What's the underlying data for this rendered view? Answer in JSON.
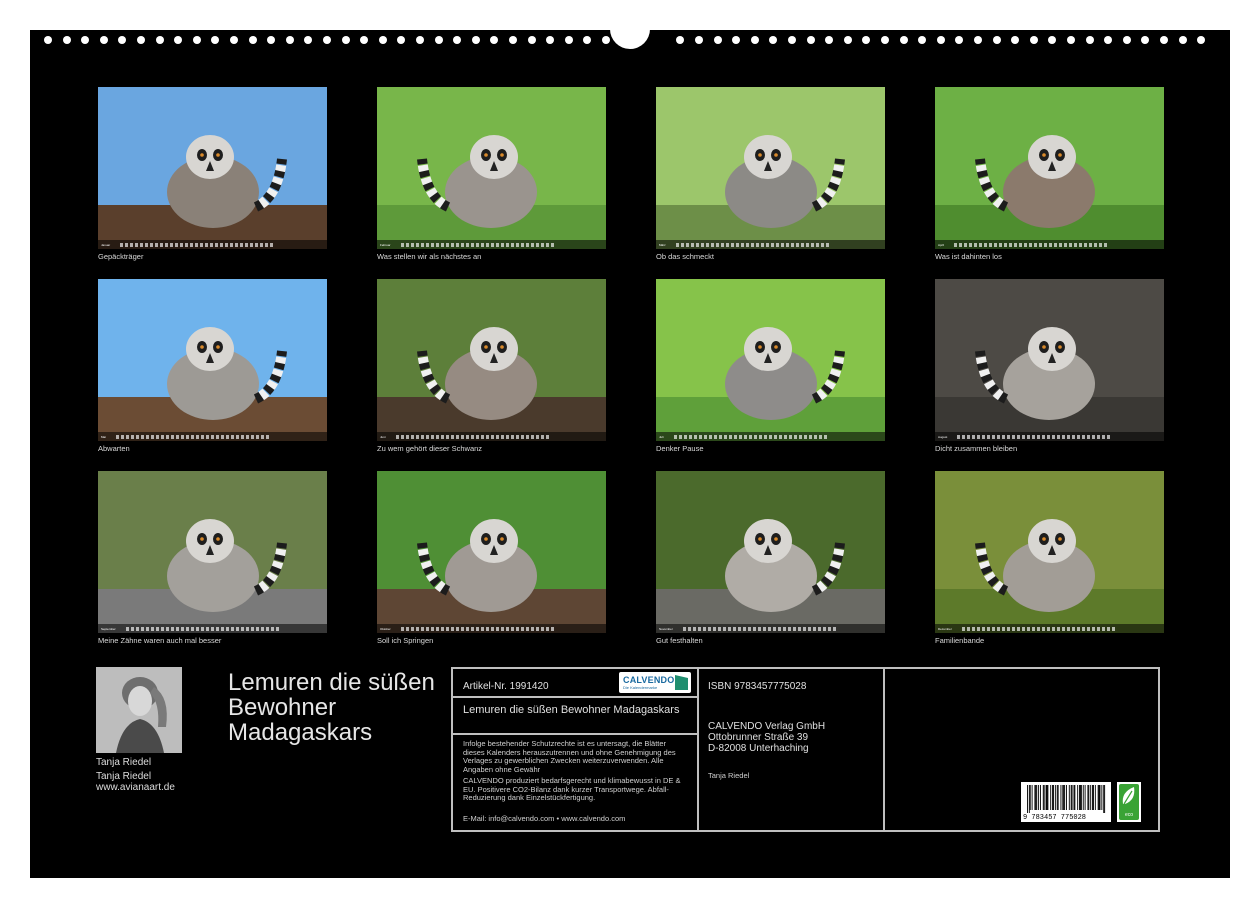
{
  "calendar": {
    "months": [
      {
        "month": "Januar",
        "caption": "Gepäckträger",
        "palette": {
          "bg": "#6aa6e0",
          "ground": "#5a3f2c",
          "subject": "#8a8178"
        }
      },
      {
        "month": "Februar",
        "caption": "Was stellen wir als nächstes an",
        "palette": {
          "bg": "#78b64a",
          "ground": "#5e9a3a",
          "subject": "#9a948e"
        }
      },
      {
        "month": "März",
        "caption": "Ob das schmeckt",
        "palette": {
          "bg": "#9cc66b",
          "ground": "#6d8f48",
          "subject": "#8c8a86"
        }
      },
      {
        "month": "April",
        "caption": "Was ist dahinten los",
        "palette": {
          "bg": "#6db045",
          "ground": "#4f8d2f",
          "subject": "#8b7a6c"
        }
      },
      {
        "month": "Mai",
        "caption": "Abwarten",
        "palette": {
          "bg": "#6fb3ec",
          "ground": "#6b4c34",
          "subject": "#9d9a95"
        }
      },
      {
        "month": "Juni",
        "caption": "Zu wem gehört dieser Schwanz",
        "palette": {
          "bg": "#5d7f3a",
          "ground": "#4a3a2c",
          "subject": "#968b82"
        }
      },
      {
        "month": "Juli",
        "caption": "Denker Pause",
        "palette": {
          "bg": "#86c34a",
          "ground": "#5fa03a",
          "subject": "#8e8c8a"
        }
      },
      {
        "month": "August",
        "caption": "Dicht zusammen bleiben",
        "palette": {
          "bg": "#4d4a45",
          "ground": "#3a3834",
          "subject": "#a6a29c"
        }
      },
      {
        "month": "September",
        "caption": "Meine Zähne waren auch mal besser",
        "palette": {
          "bg": "#6a7f4a",
          "ground": "#7a7a7a",
          "subject": "#a3a09b"
        }
      },
      {
        "month": "Oktober",
        "caption": "Soll ich Springen",
        "palette": {
          "bg": "#4f8f35",
          "ground": "#5e4634",
          "subject": "#a09a94"
        }
      },
      {
        "month": "November",
        "caption": "Gut festhalten",
        "palette": {
          "bg": "#4b6a2c",
          "ground": "#6a6a64",
          "subject": "#b0aca6"
        }
      },
      {
        "month": "Dezember",
        "caption": "Familienbande",
        "palette": {
          "bg": "#7a8f3a",
          "ground": "#5d7a2a",
          "subject": "#a29d96"
        }
      }
    ]
  },
  "author": {
    "name": "Tanja Riedel",
    "name_repeat": "Tanja Riedel",
    "website": "www.avianaart.de"
  },
  "title": {
    "line1": "Lemuren die süßen",
    "line2": "Bewohner",
    "line3": "Madagaskars"
  },
  "info": {
    "article_no": "Artikel-Nr. 1991420",
    "logo_name": "CALVENDO",
    "logo_tagline": "Die Kalendermarke",
    "full_title": "Lemuren die süßen Bewohner Madagaskars",
    "copyright_text": "Infolge bestehender Schutzrechte ist es untersagt, die Blätter dieses Kalenders herauszutrennen und ohne Genehmigung des Verlages zu gewerblichen Zwecken weiterzuverwenden. Alle Angaben ohne Gewähr",
    "climate_text": "CALVENDO produziert bedarfsgerecht und klimabewusst in DE & EU. Positivere CO2-Bilanz dank kurzer Transportwege. Abfall-Reduzierung dank Einzelstückfertigung.",
    "email": "E-Mail: info@calvendo.com • www.calvendo.com",
    "isbn": "ISBN 9783457775028",
    "publisher_name": "CALVENDO Verlag GmbH",
    "publisher_street": "Ottobrunner Straße 39",
    "publisher_city": "D-82008 Unterhaching",
    "author_credit": "Tanja Riedel",
    "barcode_digits": "9 783457 775028",
    "eco_label": "eco"
  }
}
